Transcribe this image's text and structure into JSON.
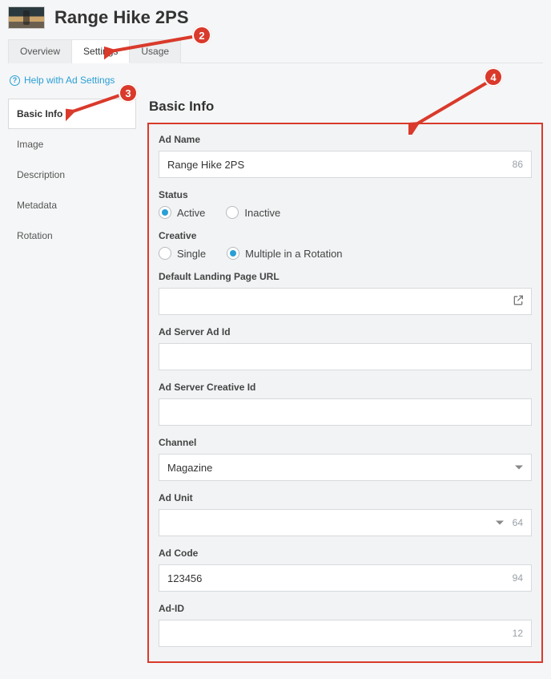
{
  "header": {
    "title": "Range Hike 2PS"
  },
  "tabs": [
    {
      "label": "Overview",
      "active": false
    },
    {
      "label": "Settings",
      "active": true
    },
    {
      "label": "Usage",
      "active": false
    }
  ],
  "help_link": "Help with Ad Settings",
  "sidebar": {
    "items": [
      "Basic Info",
      "Image",
      "Description",
      "Metadata",
      "Rotation"
    ],
    "active_index": 0
  },
  "section_title": "Basic Info",
  "fields": {
    "ad_name": {
      "label": "Ad Name",
      "value": "Range Hike 2PS",
      "count": "86"
    },
    "status": {
      "label": "Status",
      "options": [
        "Active",
        "Inactive"
      ],
      "selected": "Active"
    },
    "creative": {
      "label": "Creative",
      "options": [
        "Single",
        "Multiple in a Rotation"
      ],
      "selected": "Multiple in a Rotation"
    },
    "landing_url": {
      "label": "Default Landing Page URL",
      "value": ""
    },
    "ad_server_ad": {
      "label": "Ad Server Ad Id",
      "value": ""
    },
    "ad_server_cr": {
      "label": "Ad Server Creative Id",
      "value": ""
    },
    "channel": {
      "label": "Channel",
      "value": "Magazine"
    },
    "ad_unit": {
      "label": "Ad Unit",
      "value": "",
      "count": "64"
    },
    "ad_code": {
      "label": "Ad Code",
      "value": "123456",
      "count": "94"
    },
    "ad_id": {
      "label": "Ad-ID",
      "value": "",
      "count": "12"
    }
  },
  "annotations": {
    "a2": "2",
    "a3": "3",
    "a4": "4"
  }
}
